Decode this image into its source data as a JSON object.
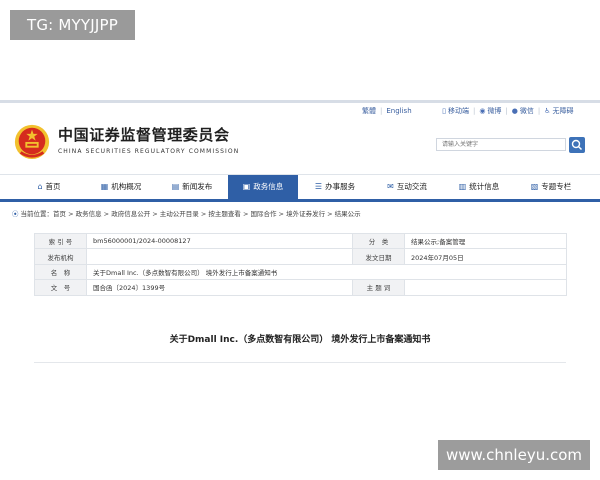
{
  "watermarks": {
    "top_left": "TG: MYYJJPP",
    "bottom_right": "www.chnleyu.com"
  },
  "utility_links": [
    {
      "label": "繁體",
      "icon": ""
    },
    {
      "label": "English",
      "icon": ""
    },
    {
      "label": "移动端",
      "icon": "mobile-icon"
    },
    {
      "label": "微博",
      "icon": "weibo-icon"
    },
    {
      "label": "微信",
      "icon": "wechat-icon"
    },
    {
      "label": "无障碍",
      "icon": "accessibility-icon"
    }
  ],
  "brand": {
    "name_cn": "中国证券监督管理委员会",
    "name_en": "CHINA SECURITIES REGULATORY COMMISSION"
  },
  "search": {
    "placeholder": "请输入关键字"
  },
  "nav": [
    {
      "label": "首页",
      "icon": "home-icon",
      "active": false
    },
    {
      "label": "机构概况",
      "icon": "building-icon",
      "active": false
    },
    {
      "label": "新闻发布",
      "icon": "news-icon",
      "active": false
    },
    {
      "label": "政务信息",
      "icon": "monitor-icon",
      "active": true
    },
    {
      "label": "办事服务",
      "icon": "service-icon",
      "active": false
    },
    {
      "label": "互动交流",
      "icon": "chat-icon",
      "active": false
    },
    {
      "label": "统计信息",
      "icon": "stats-icon",
      "active": false
    },
    {
      "label": "专题专栏",
      "icon": "topic-icon",
      "active": false
    }
  ],
  "breadcrumb": {
    "prefix": "当前位置：",
    "items": [
      "首页",
      "政务信息",
      "政府信息公开",
      "主动公开目录",
      "按主题查看",
      "国际合作",
      "境外证券发行",
      "结果公示"
    ],
    "separator": " > "
  },
  "meta": {
    "index_label": "索 引 号",
    "index_value": "bm56000001/2024-00008127",
    "category_label": "分　类",
    "category_value": "结果公示;备案管理",
    "issuer_label": "发布机构",
    "issuer_value": "",
    "date_label": "发文日期",
    "date_value": "2024年07月05日",
    "name_label": "名　称",
    "name_value": "关于Dmall Inc.（多点数智有限公司） 境外发行上市备案通知书",
    "docno_label": "文　号",
    "docno_value": "国合函〔2024〕1399号",
    "topic_label": "主 题 词",
    "topic_value": ""
  },
  "document": {
    "title": "关于Dmall Inc.（多点数智有限公司） 境外发行上市备案通知书"
  },
  "colors": {
    "primary_blue": "#2f5fa6",
    "emblem_red": "#d52b1e",
    "emblem_gold": "#f2c12e"
  }
}
